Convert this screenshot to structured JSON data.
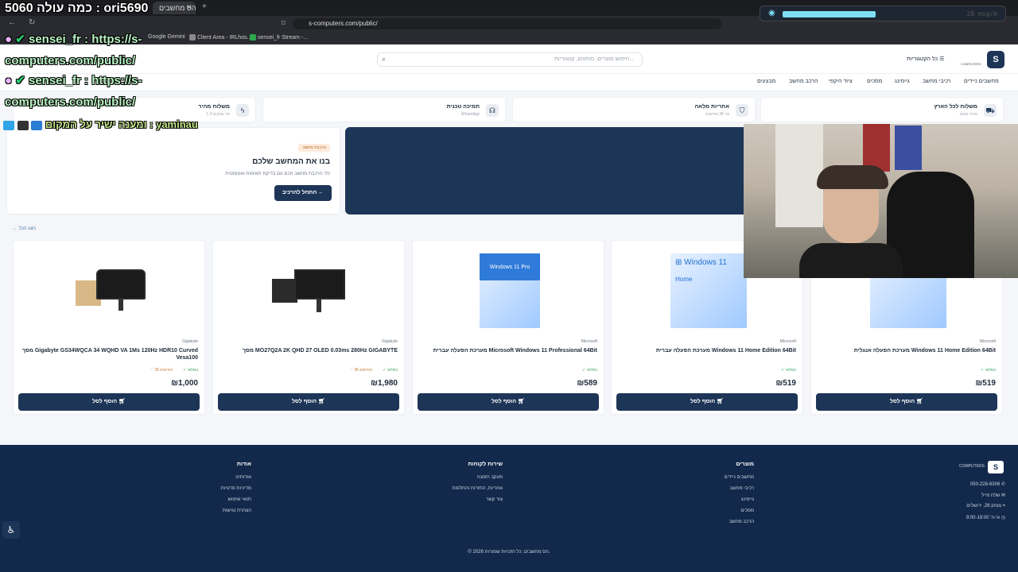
{
  "browser": {
    "tab_title": "הס מחשבים",
    "url": "s-computers.com/public/",
    "bookmarks": [
      "Google Gemini",
      "Client Area - IRLhos...",
      "sensei_fr Stream -..."
    ]
  },
  "stream": {
    "title": "כמה עולה 5060 : ori5690",
    "chat_1": "sensei_fr : https://s-computers.com/public/",
    "chat_2": "sensei_fr : https://s-computers.com/public/",
    "chat_3": "ומענה ישיר על המקום : yaminau",
    "goal_text": "28 msg/m",
    "goal_progress": 0.51
  },
  "header": {
    "logo_letter": "S",
    "logo_sub": "COMPUTERS",
    "categories_label": "כל הקטגוריות",
    "search_placeholder": "חיפוש מוצרים, מותגים, קטגוריות...",
    "nav": [
      "מחשבים ניידים",
      "רכיבי מחשב",
      "גיימינג",
      "מסכים",
      "ציוד היקפי",
      "הרכב מחשב",
      "מבצעים"
    ]
  },
  "features": [
    {
      "title": "משלוח לכל הארץ",
      "sub": "מהיר ואמין",
      "icon": "truck-icon"
    },
    {
      "title": "אחריות מלאה",
      "sub": "עד 36 חודשים",
      "icon": "shield-icon"
    },
    {
      "title": "תמיכה טכנית",
      "sub": "WhatsApp",
      "icon": "headset-icon"
    },
    {
      "title": "משלוח מהיר",
      "sub": "1-3 ימי עסקים",
      "icon": "bolt-icon"
    }
  ],
  "promo": {
    "badge": "הרכבת מחשב",
    "title": "בנו את המחשב שלכם",
    "subtitle": "כלי הרכבת מחשב חכם עם בדיקת תאימות אוטומטית",
    "button": "התחל להרכיב"
  },
  "view_all": "הצג הכל",
  "products": [
    {
      "brand": "Gigabyte",
      "name": "מסך Gigabyte GS34WQCA 34 WQHD VA 1Ms 120Hz HDR10 Curved Vesa100",
      "stock": "במלאי",
      "reviews": "36 חודשים",
      "price": "₪1,000",
      "add": "הוסף לסל",
      "img": "monitor-box"
    },
    {
      "brand": "Gigabyte",
      "name": "מסך MO27Q2A 2K QHD 27 OLED 0.03ms 280Hz GIGABYTE",
      "stock": "במלאי",
      "reviews": "36 חודשים",
      "price": "₪1,980",
      "add": "הוסף לסל",
      "img": "monitor-box-2"
    },
    {
      "brand": "Microsoft",
      "name": "מערכת הפעלה עברית Microsoft Windows 11 Professional 64Bit",
      "stock": "במלאי",
      "reviews": "",
      "price": "₪589",
      "add": "הוסף לסל",
      "img": "windows-pro"
    },
    {
      "brand": "Microsoft",
      "name": "מערכת הפעלה עברית Windows 11 Home Edition 64Bit",
      "stock": "במלאי",
      "reviews": "",
      "price": "₪519",
      "add": "הוסף לסל",
      "img": "windows-home"
    },
    {
      "brand": "Microsoft",
      "name": "מערכת הפעלה אנגלית Windows 11 Home Edition 64Bit",
      "stock": "במלאי",
      "reviews": "",
      "price": "₪519",
      "add": "הוסף לסל",
      "img": "windows-home"
    }
  ],
  "win_labels": {
    "pro": "Windows 11 Pro",
    "home": "Windows 11",
    "home_sub": "Home"
  },
  "footer": {
    "contact": {
      "phone": "050-228-6306",
      "email": "שלח מייל",
      "address": "צונזק 26, ירושלים",
      "hours": "א'-ה' 9:00-18:00"
    },
    "cols": [
      {
        "title": "מוצרים",
        "links": [
          "מחשבים ניידים",
          "רכיבי מחשב",
          "גיימינג",
          "מסכים",
          "הרכב מחשב"
        ]
      },
      {
        "title": "שירות לקוחות",
        "links": [
          "מעקב הזמנה",
          "אחריות, החזרות והחלפות",
          "צור קשר"
        ]
      },
      {
        "title": "אודות",
        "links": [
          "אודותינו",
          "מדיניות פרטיות",
          "תנאי שימוש",
          "הצהרת נגישות"
        ]
      }
    ],
    "copyright": "© 2026 הס מחשבים. כל הזכויות שמורות."
  },
  "colors": {
    "primary": "#1d3557",
    "footer": "#13294b",
    "stock": "#2a9d5a"
  }
}
